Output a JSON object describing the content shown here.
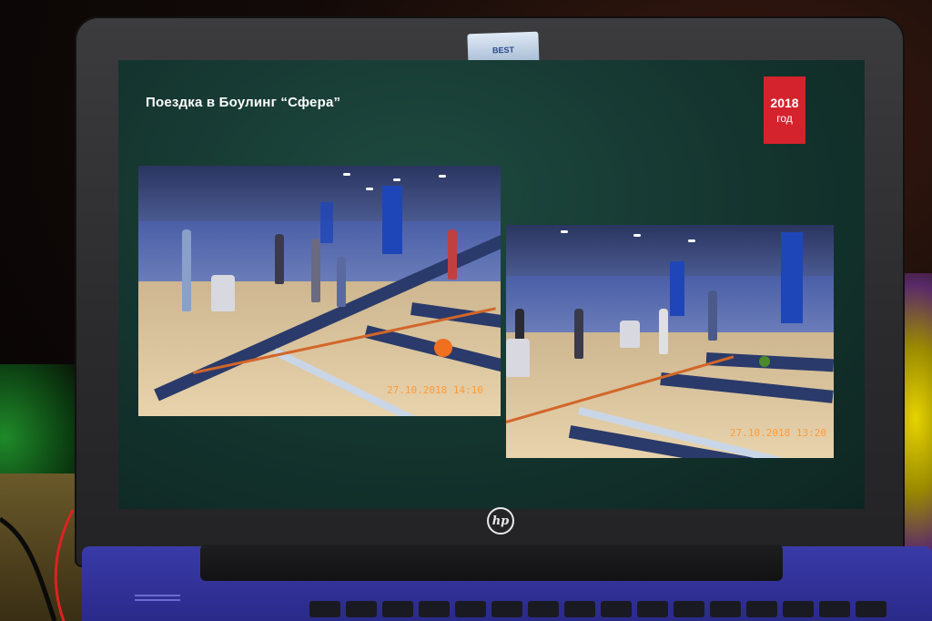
{
  "slide": {
    "title": "Поездка в Боулинг “Сфера”",
    "year": "2018",
    "year_suffix": "год"
  },
  "photos": [
    {
      "timestamp": "27.10.2018 14:10"
    },
    {
      "timestamp": "27.10.2018 13:20"
    }
  ],
  "laptop": {
    "brand": "hp",
    "sticker_text": "BEST"
  },
  "colors": {
    "slide_bg": "#14342e",
    "badge_red": "#d4232d",
    "laptop_lid": "#2a2a2c",
    "keyboard_deck": "#2a2a8a"
  }
}
